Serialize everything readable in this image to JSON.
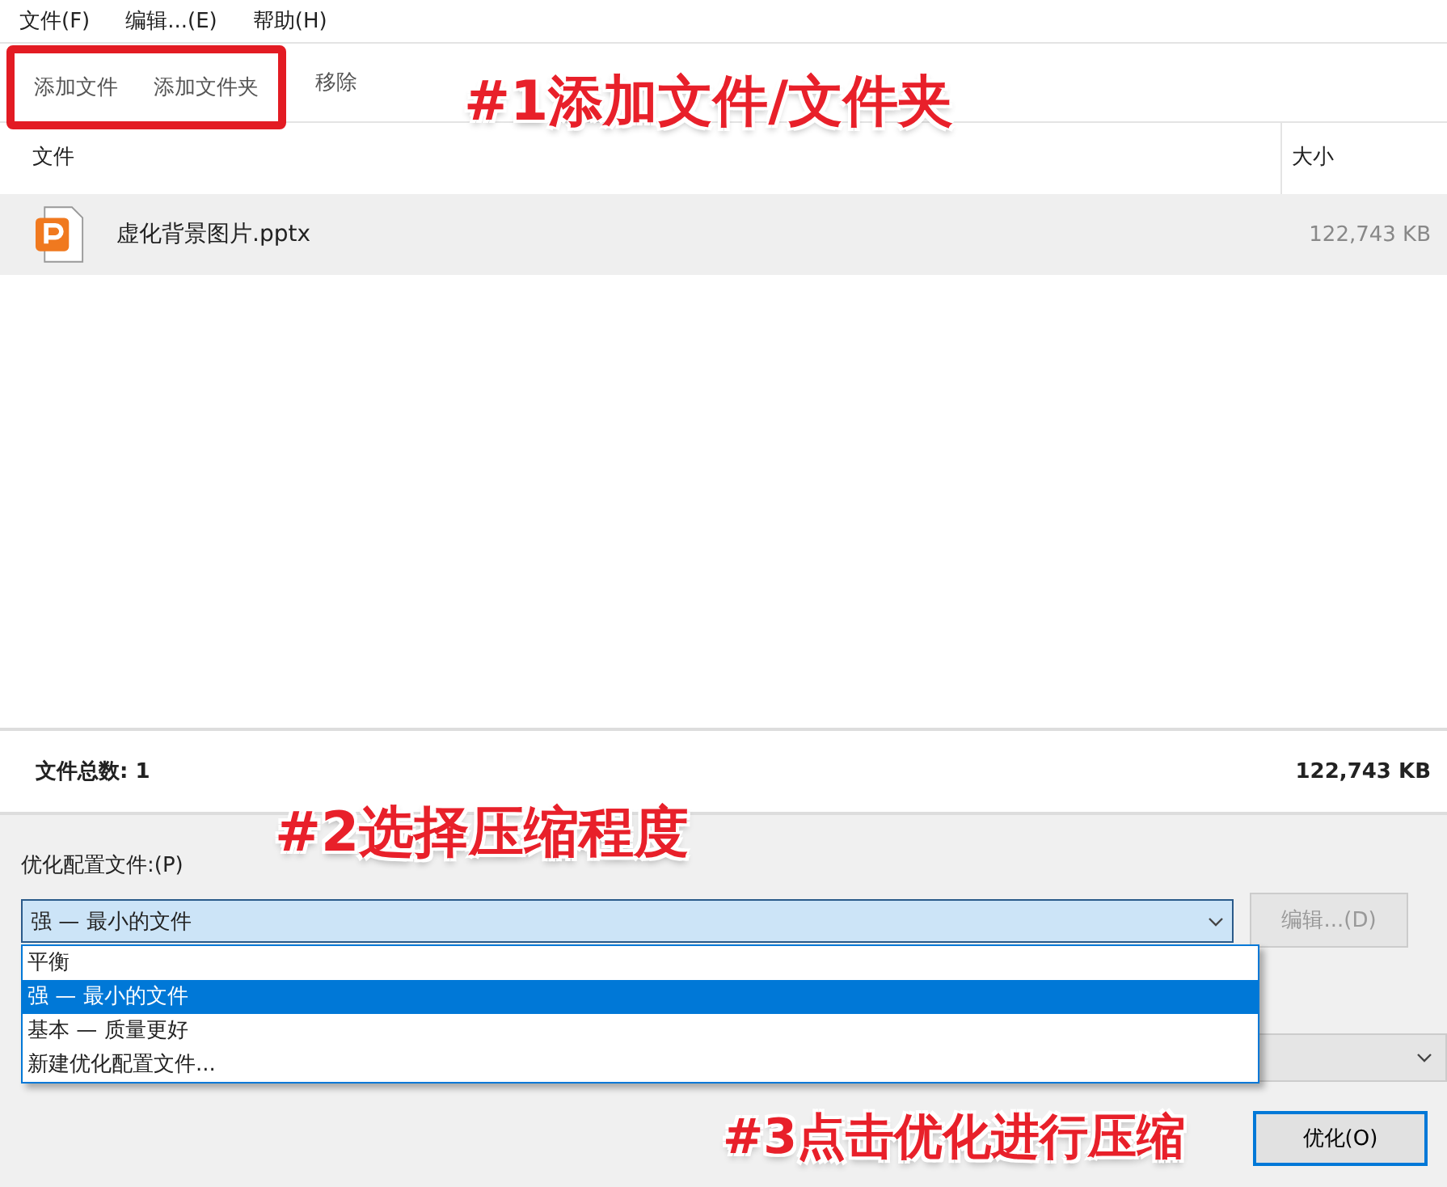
{
  "menu": [
    "文件(F)",
    "编辑...(E)",
    "帮助(H)"
  ],
  "toolbar": [
    {
      "label": "添加文件",
      "highlighted": true
    },
    {
      "label": "添加文件夹",
      "highlighted": true
    },
    {
      "label": "移除",
      "highlighted": false
    }
  ],
  "table": {
    "columns": [
      "文件",
      "大小"
    ],
    "rows": [
      {
        "name": "虚化背景图片.pptx",
        "size": "122,743 KB",
        "selected": true
      }
    ]
  },
  "summary": {
    "label": "文件总数: 1",
    "size": "122,743 KB"
  },
  "profile": {
    "label": "优化配置文件:(P)",
    "value": "强 — 最小的文件",
    "expanded": true,
    "options": [
      {
        "label": "平衡",
        "selected": false
      },
      {
        "label": "强 — 最小的文件",
        "selected": true
      },
      {
        "label": "基本 — 质量更好",
        "selected": false
      },
      {
        "label": "新建优化配置文件...",
        "selected": false
      }
    ],
    "edit_button": {
      "label": "编辑...(D)",
      "disabled": true
    }
  },
  "optimize_button": {
    "label": "优化(O)"
  },
  "annotations": [
    "#1添加文件/文件夹",
    "#2选择压缩程度",
    "#3点击优化进行压缩"
  ]
}
